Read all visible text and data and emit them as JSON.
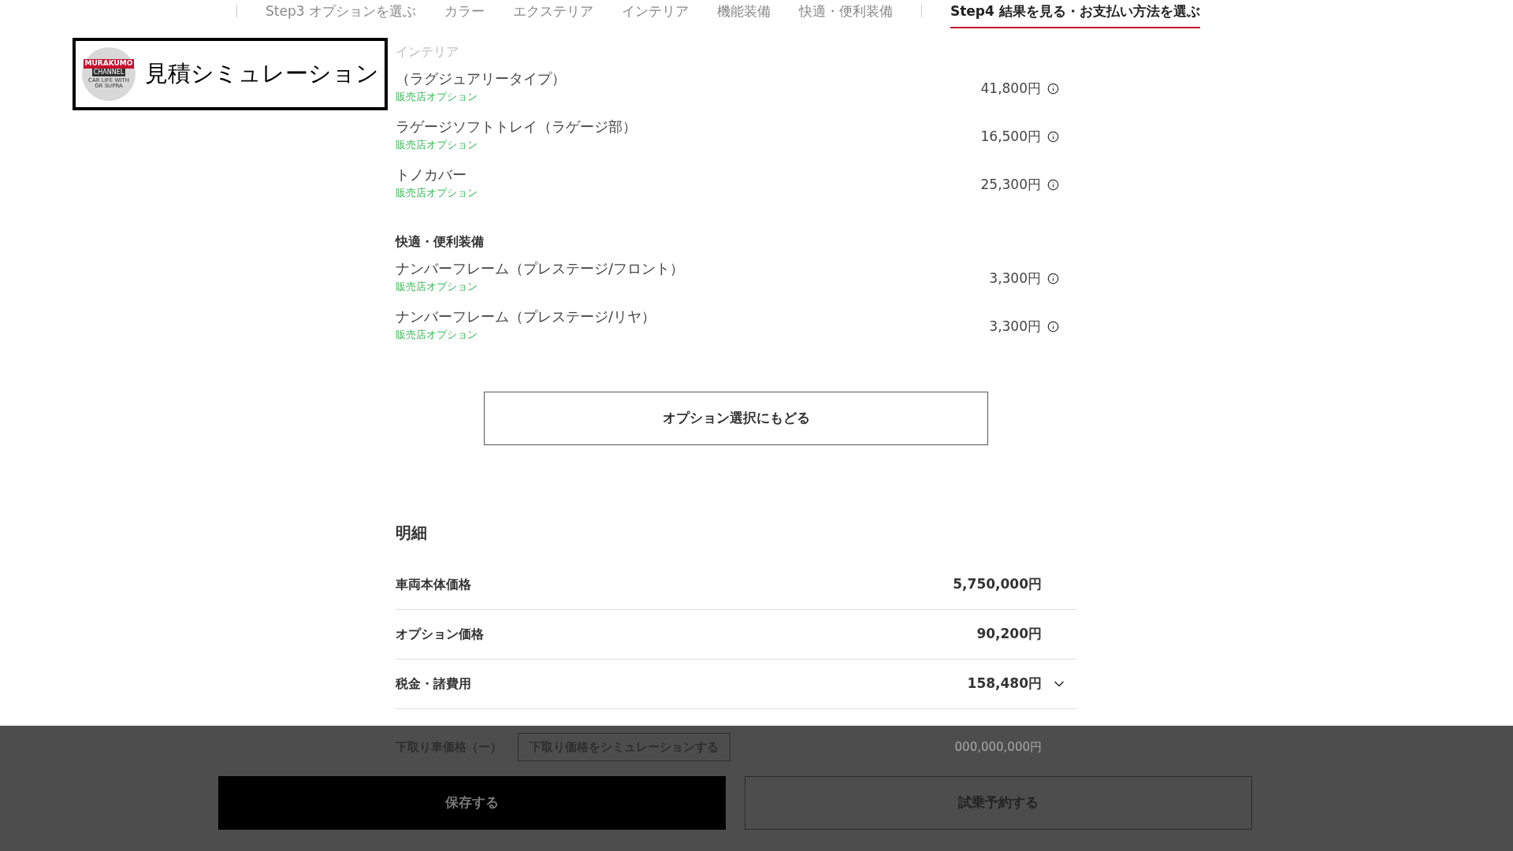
{
  "nav": {
    "items": [
      {
        "label": "Step3 オプションを選ぶ",
        "kind": "step",
        "selected": false
      },
      {
        "label": "カラー",
        "kind": "sub",
        "selected": false
      },
      {
        "label": "エクステリア",
        "kind": "sub",
        "selected": false
      },
      {
        "label": "インテリア",
        "kind": "sub",
        "selected": false
      },
      {
        "label": "機能装備",
        "kind": "sub",
        "selected": false
      },
      {
        "label": "快適・便利装備",
        "kind": "sub",
        "selected": false
      },
      {
        "label": "Step4 結果を見る・お支払い方法を選ぶ",
        "kind": "step",
        "selected": true
      }
    ]
  },
  "title_card": {
    "title": "見積シミュレーション",
    "logo_lines": [
      "MURAKUMO",
      "CHANNEL",
      "CAR LIFE WITH GR SUPRA"
    ]
  },
  "sections": [
    {
      "heading": "インテリア",
      "items": [
        {
          "name": "（ラグジュアリータイプ）",
          "tag": "販売店オプション",
          "price": "41,800円"
        },
        {
          "name": "ラゲージソフトトレイ（ラゲージ部）",
          "tag": "販売店オプション",
          "price": "16,500円"
        },
        {
          "name": "トノカバー",
          "tag": "販売店オプション",
          "price": "25,300円"
        }
      ]
    },
    {
      "heading": "快適・便利装備",
      "items": [
        {
          "name": "ナンバーフレーム（プレステージ/フロント）",
          "tag": "販売店オプション",
          "price": "3,300円"
        },
        {
          "name": "ナンバーフレーム（プレステージ/リヤ）",
          "tag": "販売店オプション",
          "price": "3,300円"
        }
      ]
    }
  ],
  "back_button": "オプション選択にもどる",
  "details": {
    "heading": "明細",
    "rows": [
      {
        "label": "車両本体価格",
        "value": "5,750,000円",
        "kind": "plain"
      },
      {
        "label": "オプション価格",
        "value": "90,200円",
        "kind": "plain"
      },
      {
        "label": "税金・諸費用",
        "value": "158,480円",
        "kind": "expandable",
        "expanded": false
      }
    ]
  },
  "trade_in": {
    "label": "下取り車価格（ー）",
    "button": "下取り価格をシミュレーションする",
    "value": "000,000,000円"
  },
  "actions": [
    {
      "label": "保存する",
      "kind": "primary"
    },
    {
      "label": "試乗予約する",
      "kind": "outline"
    }
  ]
}
